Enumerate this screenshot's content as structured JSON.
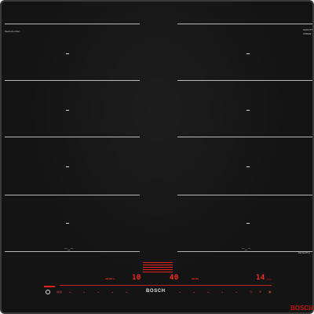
{
  "brand": {
    "name": "BOSCH",
    "watermark": "BOSCH"
  },
  "left_zone_labels": {
    "combi_tag": "flexInduction"
  },
  "right_zone_labels": {
    "top_tag_line1": "SCHOTT",
    "top_tag_line2": "CERAN",
    "bottom_tag": "PerfectFry"
  },
  "zone_icons": {
    "bridge_left": "⁀—⁀",
    "bridge_right": "⁀—⁀"
  },
  "displays": {
    "left_power": "10",
    "center_power": "40",
    "timer": "14",
    "timer_unit": "min"
  },
  "control_symbols": {
    "power": "power-icon",
    "flex": "flex-icon",
    "slider_scale": [
      "0",
      "1",
      "2",
      "3",
      "4",
      "5",
      "6",
      "7",
      "8",
      "9"
    ],
    "right_buttons": [
      "timer-icon",
      "lock-icon",
      "wipe-icon"
    ]
  },
  "colors": {
    "glass": "#141414",
    "frame": "#3a3a3a",
    "zone_lines": "#c9c9c9",
    "accent_red": "#e2231a"
  }
}
